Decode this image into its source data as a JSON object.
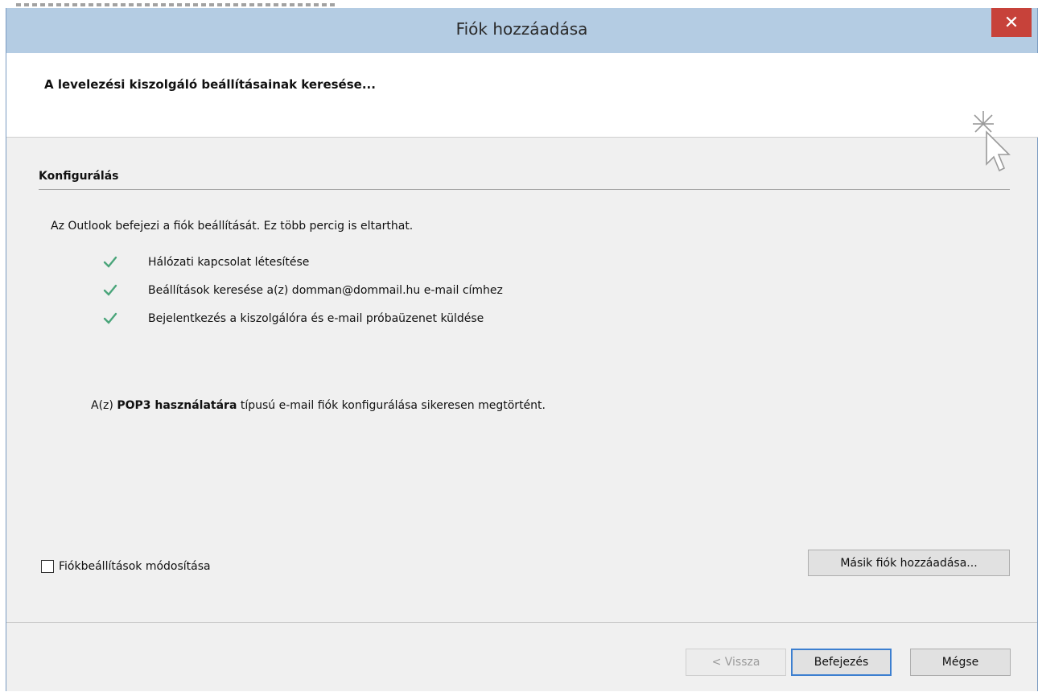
{
  "window": {
    "title": "Fiók hozzáadása",
    "close_label": "✕"
  },
  "header": {
    "title": "A levelezési kiszolgáló beállításainak keresése..."
  },
  "section": {
    "title": "Konfigurálás",
    "intro": "Az Outlook befejezi a fiók beállítását. Ez több percig is eltarthat.",
    "steps": [
      {
        "label": "Hálózati kapcsolat létesítése",
        "icon": "check-icon"
      },
      {
        "label": "Beállítások keresése a(z) domman@dommail.hu e-mail címhez",
        "icon": "check-icon"
      },
      {
        "label": "Bejelentkezés a kiszolgálóra és e-mail próbaüzenet küldése",
        "icon": "check-icon"
      }
    ],
    "result": {
      "prefix": "A(z) ",
      "bold": "POP3 használatára",
      "suffix": " típusú e-mail fiók konfigurálása sikeresen megtörtént."
    }
  },
  "options": {
    "modify_checkbox_label": "Fiókbeállítások módosítása",
    "modify_checked": false,
    "add_another_label": "Másik fiók hozzáadása..."
  },
  "footer": {
    "back_label": "< Vissza",
    "finish_label": "Befejezés",
    "cancel_label": "Mégse"
  },
  "colors": {
    "titlebar": "#b4cce3",
    "close": "#c7423a",
    "check": "#4aa57a",
    "default_button_border": "#3c7fd0"
  }
}
